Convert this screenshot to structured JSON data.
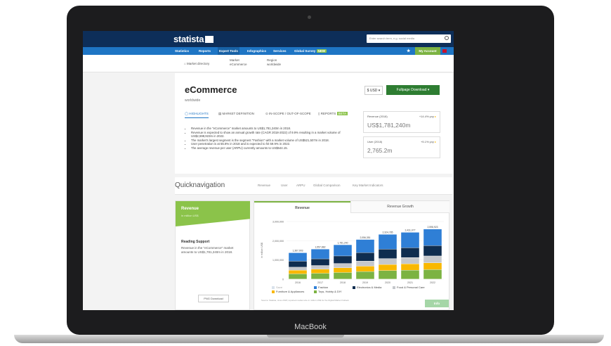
{
  "device": {
    "brand": "MacBook"
  },
  "header": {
    "logo": "statista",
    "search_placeholder": "Enter search term, e.g. social media",
    "nav": [
      "Statistics",
      "Reports",
      "Expert Tools",
      "Infographics",
      "Services",
      "Global Survey"
    ],
    "nav_active": "Expert Tools",
    "new_badge": "NEW",
    "my_account": "My Account"
  },
  "subnav": {
    "home": "Market directory",
    "market_label": "Market",
    "market_value": "eCommerce",
    "region_label": "Region",
    "region_value": "worldwide"
  },
  "main": {
    "title": "eCommerce",
    "subtitle": "worldwide",
    "currency": "$ USD",
    "download": "Fullpage Download",
    "tabs": [
      "HIGHLIGHTS",
      "MARKET DEFINITION",
      "IN-SCOPE / OUT-OF-SCOPE",
      "REPORTS"
    ],
    "reports_badge": "BETA",
    "bullets": [
      "Revenue in the \"eCommerce\" market amounts to US$1,781,240m in 2018.",
      "Revenue is expected to show an annual growth rate (CAGR 2018-2022) of 9.9% resulting in a market volume of US$2,598,923m in 2022.",
      "The market's largest segment is the segment \"Fashion\" with a market volume of US$521,507m in 2018.",
      "User penetration is at 55.8% in 2018 and is expected to hit 59.9% in 2022.",
      "The average revenue per user (ARPU) currently amounts to US$644.15."
    ],
    "kpis": [
      {
        "label": "Revenue (2018)",
        "growth": "+14.4% yoy",
        "value": "US$1,781,240m"
      },
      {
        "label": "User (2018)",
        "growth": "+5.1% yoy",
        "value": "2,765.2m"
      }
    ]
  },
  "quicknav": {
    "title": "Quicknavigation",
    "links": [
      "Revenue",
      "User",
      "ARPU",
      "Global Comparison",
      "Key Market Indicators"
    ]
  },
  "side_card": {
    "title": "Revenue",
    "subtitle": "in million US$",
    "reading_title": "Reading Support",
    "reading_text": "Revenue in the \"eCommerce\" market amounts to US$1,781,240m in 2018.",
    "pdf_button": "PNG Download"
  },
  "chart_tabs": [
    "Revenue",
    "Revenue Growth"
  ],
  "chart_data": {
    "type": "bar",
    "stacked": true,
    "categories": [
      "2016",
      "2017",
      "2018",
      "2019",
      "2020",
      "2021",
      "2022"
    ],
    "totals": [
      1367903,
      1557882,
      1781240,
      2056351,
      2324785,
      2431077,
      2598923
    ],
    "total_labels": [
      "1,367,903",
      "1,557,882",
      "1,781,240",
      "2,056,351",
      "2,324,785",
      "2,431,077",
      "2,598,923"
    ],
    "ylabel": "in million US$",
    "ylim": [
      0,
      3000000
    ],
    "yticks": [
      "0",
      "1,000,000",
      "2,000,000",
      "3,000,000"
    ],
    "series": [
      {
        "name": "Toys, Hobby & DIY",
        "color": "#7cb342",
        "values": [
          270000,
          300000,
          340000,
          390000,
          440000,
          460000,
          490000
        ]
      },
      {
        "name": "Furniture & Appliances",
        "color": "#f9b800",
        "values": [
          190000,
          215000,
          245000,
          280000,
          315000,
          330000,
          352000
        ]
      },
      {
        "name": "Food & Personal Care",
        "color": "#c5c8cc",
        "values": [
          160000,
          190000,
          225000,
          265000,
          310000,
          330000,
          360000
        ]
      },
      {
        "name": "Electronics & Media",
        "color": "#0f2d4f",
        "values": [
          310000,
          345000,
          391000,
          440000,
          490000,
          508000,
          537000
        ]
      },
      {
        "name": "Fashion",
        "color": "#2f7fd6",
        "values": [
          437903,
          507882,
          580240,
          681351,
          769785,
          803077,
          859923
        ]
      }
    ],
    "legend_extra": "Save"
  },
  "footer": {
    "source": "Source: Statista, June 2018; reported market size in million US$ for the Digital Market Outlook",
    "info": "Info"
  }
}
